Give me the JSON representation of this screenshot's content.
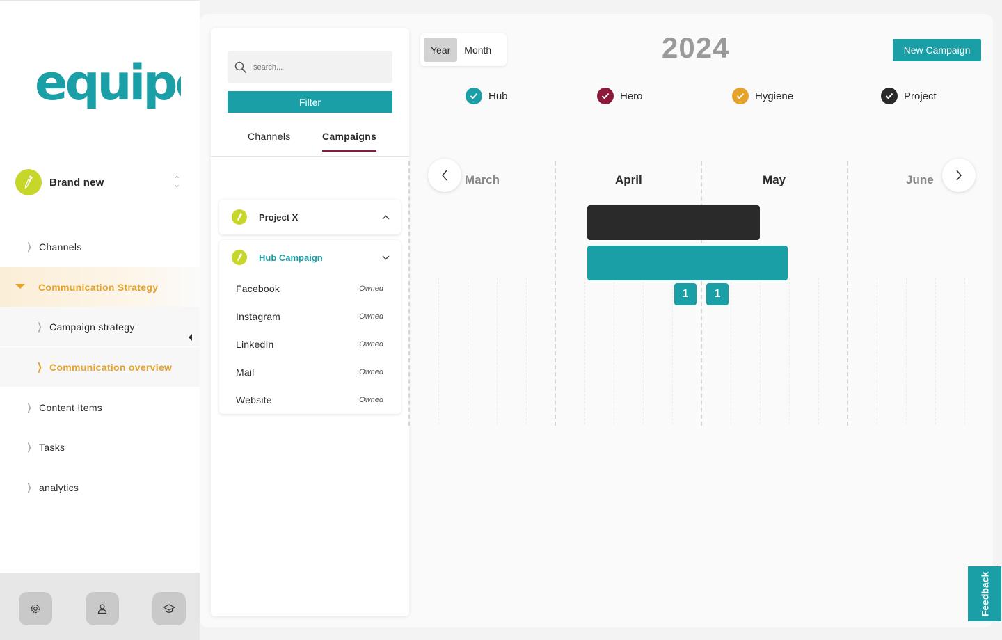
{
  "logo": {
    "text": "equipo",
    "color": "#1a9fa6"
  },
  "brand": {
    "name": "Brand new",
    "badge_color": "#c6d62a",
    "icon": "pen-nib-icon"
  },
  "sidebar": {
    "items": [
      {
        "label": "Channels"
      },
      {
        "label": "Communication Strategy"
      },
      {
        "label": "Campaign strategy"
      },
      {
        "label": "Communication overview"
      },
      {
        "label": "Content Items"
      },
      {
        "label": "Tasks"
      },
      {
        "label": "analytics"
      }
    ],
    "accent": "#e5a32a",
    "bottom_icons": [
      "settings-icon",
      "user-icon",
      "graduation-cap-icon"
    ]
  },
  "panel": {
    "search_placeholder": "search...",
    "filter_label": "Filter",
    "tabs": [
      {
        "label": "Channels"
      },
      {
        "label": "Campaigns"
      }
    ],
    "project": {
      "title": "Project X"
    },
    "campaign": {
      "title": "Hub Campaign",
      "channels": [
        {
          "name": "Facebook",
          "type": "Owned"
        },
        {
          "name": "Instagram",
          "type": "Owned"
        },
        {
          "name": "LinkedIn",
          "type": "Owned"
        },
        {
          "name": "Mail",
          "type": "Owned"
        },
        {
          "name": "Website",
          "type": "Owned"
        }
      ]
    }
  },
  "calendar": {
    "view_options": [
      "Year",
      "Month"
    ],
    "selected_view": "Year",
    "year": "2024",
    "new_campaign_label": "New Campaign",
    "legend": [
      {
        "label": "Hub",
        "color": "#1a9fa6"
      },
      {
        "label": "Hero",
        "color": "#8c1b3a"
      },
      {
        "label": "Hygiene",
        "color": "#e5a32a"
      },
      {
        "label": "Project",
        "color": "#2a2a2a"
      }
    ],
    "months": [
      "March",
      "April",
      "May",
      "June"
    ],
    "bars": [
      {
        "type": "Project",
        "color": "#2a2a2a"
      },
      {
        "type": "Hub",
        "color": "#1a9fa6"
      }
    ],
    "counts": [
      "1",
      "1"
    ]
  },
  "feedback_label": "Feedback"
}
